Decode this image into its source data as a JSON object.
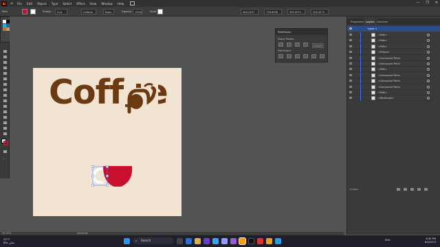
{
  "app": {
    "logo": "Ai",
    "menus": [
      "File",
      "Edit",
      "Object",
      "Type",
      "Select",
      "Effect",
      "View",
      "Window",
      "Help"
    ],
    "window_controls": [
      "—",
      "❐",
      "✕"
    ]
  },
  "control_bar": {
    "selection_label": "Path",
    "stroke_label": "Stroke:",
    "stroke_value": "0 pt",
    "uniform_label": "Uniform",
    "basic_label": "Basic",
    "opacity_label": "Opacity:",
    "opacity_value": "100%",
    "style_label": "Style:",
    "x_value": "464.2407 px",
    "y_value": "726.6956 px",
    "w_value": "395.3971 px",
    "h_value": "206.3272 px"
  },
  "artwork": {
    "headline": "Coffee",
    "colors": {
      "brown": "#6b3a12",
      "cup_red": "#c8102e",
      "artboard": "#f1e4d3",
      "selection": "#4a7dff"
    }
  },
  "status": {
    "zoom": "35.25%",
    "tool": "Selection"
  },
  "pathfinder": {
    "title": "Pathfinder",
    "shape_modes_label": "Shape Modes:",
    "pathfinders_label": "Pathfinders:",
    "expand_label": "Expand"
  },
  "right_panel": {
    "tabs": [
      "Properties",
      "Layers",
      "Libraries"
    ],
    "layer_name": "Layer 1",
    "rows": [
      "<Path>",
      "<Path>",
      "<Path>",
      "<Ellipse>",
      "<Compound Path>",
      "<Compound Path>",
      "<Path>",
      "<Compound Path>",
      "<Compound Path>",
      "<Compound Path>",
      "<Path>",
      "<Rectangle>"
    ],
    "footer": "1 Layer"
  },
  "taskbar": {
    "temperature": "25°C",
    "weather_text": "صافٍ غالبًا",
    "search_label": "Search",
    "tray": "ENG",
    "time": "8:35 PM",
    "date": "8/4/2023"
  }
}
